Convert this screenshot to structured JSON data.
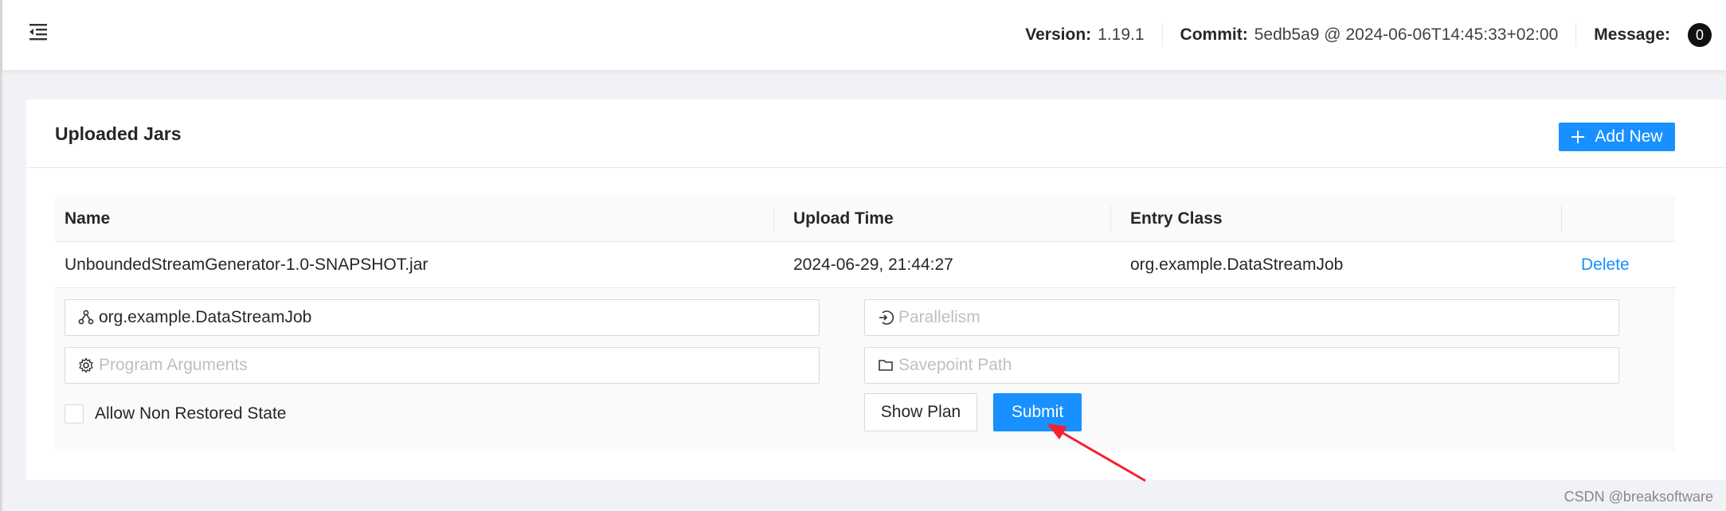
{
  "header": {
    "version_label": "Version:",
    "version_value": "1.19.1",
    "commit_label": "Commit:",
    "commit_value": "5edb5a9 @ 2024-06-06T14:45:33+02:00",
    "message_label": "Message:",
    "message_count": "0"
  },
  "card": {
    "title": "Uploaded Jars",
    "add_new_label": "Add New"
  },
  "table": {
    "columns": [
      "Name",
      "Upload Time",
      "Entry Class",
      ""
    ],
    "rows": [
      {
        "name": "UnboundedStreamGenerator-1.0-SNAPSHOT.jar",
        "upload_time": "2024-06-29, 21:44:27",
        "entry_class": "org.example.DataStreamJob",
        "action": "Delete"
      }
    ]
  },
  "submit_form": {
    "entry_class_value": "org.example.DataStreamJob",
    "parallelism_placeholder": "Parallelism",
    "program_args_placeholder": "Program Arguments",
    "savepoint_placeholder": "Savepoint Path",
    "allow_non_restored_label": "Allow Non Restored State",
    "allow_non_restored_checked": false,
    "show_plan_label": "Show Plan",
    "submit_label": "Submit"
  },
  "annotation": {
    "arrow_color": "#f5222d"
  },
  "watermark": "CSDN @breaksoftware",
  "colors": {
    "primary": "#1890ff",
    "badge": "#111111"
  }
}
